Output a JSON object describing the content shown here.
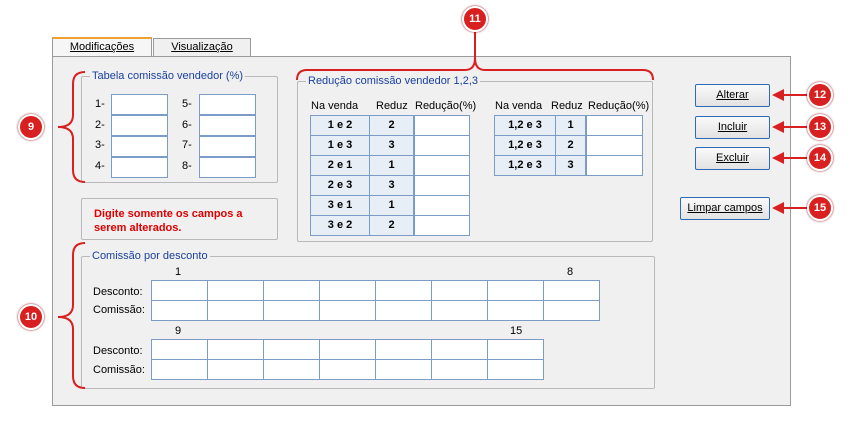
{
  "tabs": [
    {
      "label": "Modificações"
    },
    {
      "label": "Visualização"
    }
  ],
  "tabela": {
    "legend": "Tabela comissão vendedor (%)",
    "labels": [
      "1-",
      "2-",
      "3-",
      "4-",
      "5-",
      "6-",
      "7-",
      "8-"
    ]
  },
  "warning": {
    "line1": "Digite somente os campos a",
    "line2": "serem alterados."
  },
  "reducao": {
    "legend": "Redução comissão vendedor 1,2,3",
    "headers": {
      "na_venda": "Na venda",
      "reduz": "Reduz",
      "reducao": "Redução(%)"
    },
    "left_rows": [
      {
        "venda": "1 e 2",
        "reduz": "2"
      },
      {
        "venda": "1 e 3",
        "reduz": "3"
      },
      {
        "venda": "2 e 1",
        "reduz": "1"
      },
      {
        "venda": "2 e 3",
        "reduz": "3"
      },
      {
        "venda": "3 e 1",
        "reduz": "1"
      },
      {
        "venda": "3 e 2",
        "reduz": "2"
      }
    ],
    "right_rows": [
      {
        "venda": "1,2 e 3",
        "reduz": "1"
      },
      {
        "venda": "1,2 e 3",
        "reduz": "2"
      },
      {
        "venda": "1,2 e 3",
        "reduz": "3"
      }
    ]
  },
  "comissao_desconto": {
    "legend": "Comissão por desconto",
    "row1_start": "1",
    "row1_end": "8",
    "row2_start": "9",
    "row2_end": "15",
    "desconto_label": "Desconto:",
    "comissao_label": "Comissão:"
  },
  "buttons": {
    "alterar": "Alterar",
    "incluir": "Incluir",
    "excluir": "Excluir",
    "limpar": "Limpar campos"
  },
  "callouts": [
    "9",
    "10",
    "11",
    "12",
    "13",
    "14",
    "15"
  ],
  "colors": {
    "callout": "#d82020",
    "legend_text": "#1a3fa0",
    "warning_text": "#e00000"
  }
}
